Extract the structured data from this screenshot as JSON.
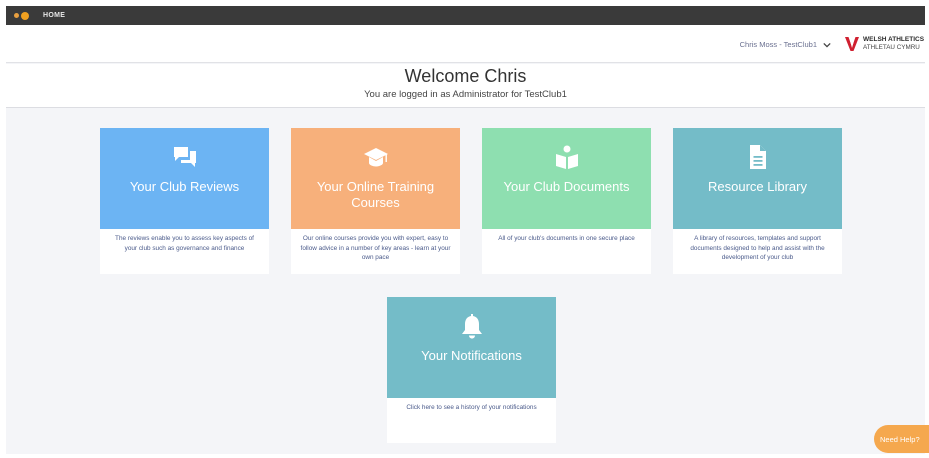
{
  "topbar": {
    "home_label": "HOME"
  },
  "header": {
    "user_label": "Chris Moss - TestClub1",
    "logo_line1": "WELSH ATHLETICS",
    "logo_line2": "ATHLETAU CYMRU"
  },
  "welcome": {
    "title": "Welcome Chris",
    "subtitle": "You are logged in as Administrator for TestClub1"
  },
  "cards": [
    {
      "title": "Your Club Reviews",
      "icon": "chat-bubbles-icon",
      "color": "#6cb4f3",
      "description": "The reviews enable you to assess key aspects of your club such as governance and finance"
    },
    {
      "title": "Your Online Training Courses",
      "icon": "graduation-cap-icon",
      "color": "#f7b07b",
      "description": "Our online courses provide you with expert, easy to follow advice in a number of key areas - learn at your own pace"
    },
    {
      "title": "Your Club Documents",
      "icon": "book-reader-icon",
      "color": "#8edfb0",
      "description": "All of your club's documents in one secure place"
    },
    {
      "title": "Resource Library",
      "icon": "document-icon",
      "color": "#74bcc8",
      "description": "A library of resources, templates and support documents designed to help and assist with the development of your club"
    },
    {
      "title": "Your Notifications",
      "icon": "bell-icon",
      "color": "#74bcc8",
      "description": "Click here to see a history of your notifications"
    }
  ],
  "help": {
    "label": "Need Help?"
  },
  "colors": {
    "topbar": "#3a3a3a",
    "background": "#f4f5f8",
    "help": "#f5a84e",
    "accent": "#f0a020"
  }
}
